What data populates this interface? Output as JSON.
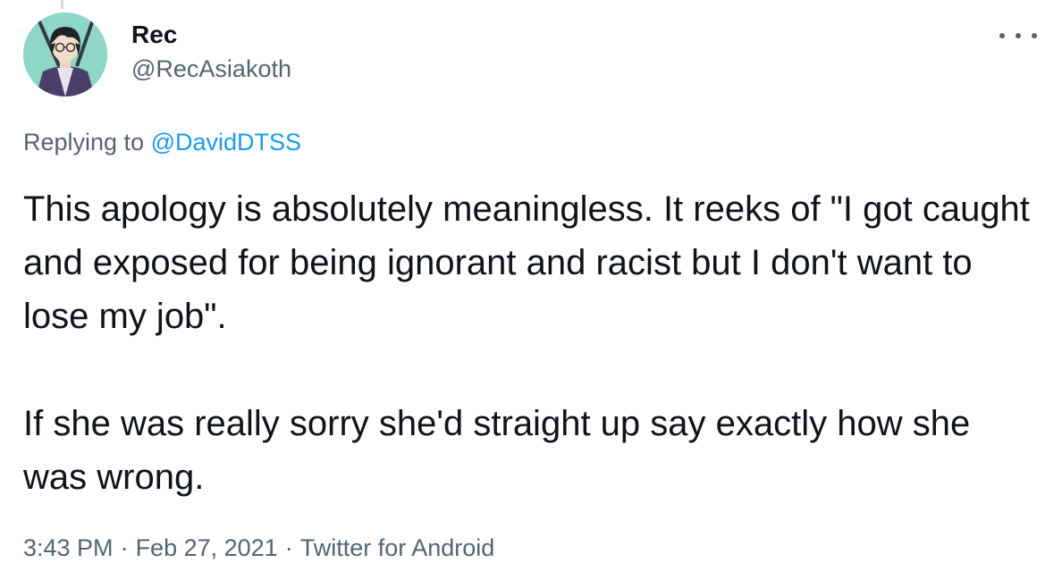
{
  "author": {
    "name": "Rec",
    "handle": "@RecAsiakoth"
  },
  "reply": {
    "prefix": "Replying to ",
    "mention": "@DavidDTSS"
  },
  "tweet": {
    "paragraph_1": "This apology is absolutely meaningless. It reeks of \"I got caught and exposed for being ignorant and racist but I don't want to lose my job\".",
    "paragraph_2": "If she was really sorry she'd straight up say exactly how she was wrong."
  },
  "meta": {
    "time": "3:43 PM",
    "separator": "·",
    "date": "Feb 27, 2021",
    "source": "Twitter for Android"
  },
  "icons": {
    "more": "more-icon"
  },
  "colors": {
    "text_primary": "#0f1419",
    "text_secondary": "#536471",
    "link": "#1d9bf0"
  }
}
